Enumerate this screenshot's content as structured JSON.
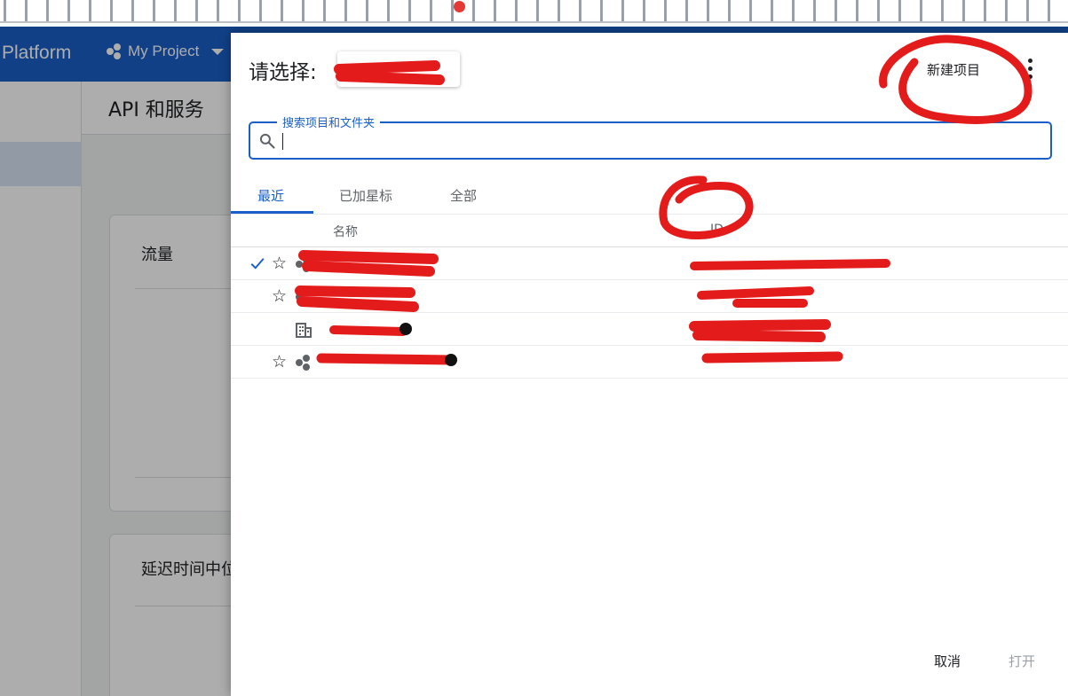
{
  "app": {
    "brand": "Platform",
    "project": "My Project"
  },
  "background": {
    "header_title": "API 和服务",
    "cards": [
      {
        "title": "流量"
      },
      {
        "title": "延迟时间中位"
      }
    ]
  },
  "dialog": {
    "title": "请选择:",
    "new_project_label": "新建项目",
    "search": {
      "label": "搜索项目和文件夹",
      "value": ""
    },
    "tabs": [
      {
        "label": "最近",
        "active": true
      },
      {
        "label": "已加星标",
        "active": false
      },
      {
        "label": "全部",
        "active": false
      }
    ],
    "columns": {
      "name": "名称",
      "id": "ID"
    },
    "rows": [
      {
        "selected": true,
        "starred": false,
        "type": "project-icon"
      },
      {
        "selected": false,
        "starred": false,
        "type": "project-icon"
      },
      {
        "selected": false,
        "starred": null,
        "type": "organization-icon"
      },
      {
        "selected": false,
        "starred": false,
        "type": "project-icon"
      }
    ],
    "footer": {
      "cancel_label": "取消",
      "open_label": "打开"
    }
  },
  "colors": {
    "appbar": "#1a5fc7",
    "accent": "#1a5fc7",
    "redaction": "#e31b1b"
  }
}
